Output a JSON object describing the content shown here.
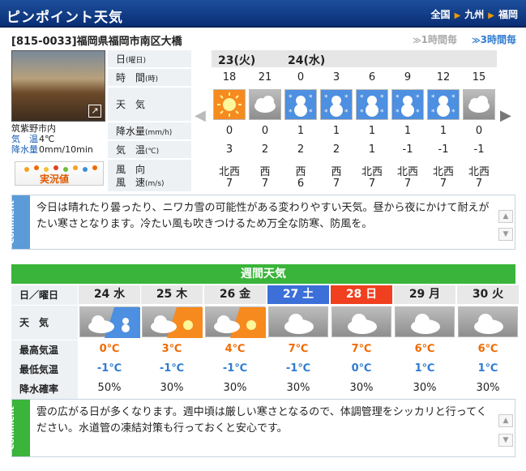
{
  "header": {
    "title": "ピンポイント天気",
    "breadcrumb": [
      "全国",
      "九州",
      "福岡"
    ]
  },
  "location": {
    "address": "[815-0033]福岡県福岡市南区大橋"
  },
  "tabs": {
    "hourly": "1時間毎",
    "threehour": "3時間毎"
  },
  "camera": {
    "place": "筑紫野市内",
    "temp_label": "気　温",
    "temp": "4℃",
    "precip_label": "降水量",
    "precip": "0mm/10min",
    "live": "実況値"
  },
  "rows": {
    "date": "日",
    "date_small": "(曜日)",
    "time": "時　間",
    "time_small": "(時)",
    "weather": "天　気",
    "precip": "降水量",
    "precip_small": "(mm/h)",
    "temp": "気　温",
    "temp_small": "(℃)",
    "wind1": "風　向",
    "wind2": "風　速",
    "wind_small": "(m/s)"
  },
  "dates": [
    "23(火)",
    "24(水)"
  ],
  "hours": [
    {
      "time": "18",
      "icon": "sunny",
      "precip": "0",
      "temp": "3",
      "dir": "北西",
      "speed": "7"
    },
    {
      "time": "21",
      "icon": "cloudy",
      "precip": "0",
      "temp": "2",
      "dir": "西",
      "speed": "7"
    },
    {
      "time": "0",
      "icon": "snow",
      "precip": "1",
      "temp": "2",
      "dir": "西",
      "speed": "6"
    },
    {
      "time": "3",
      "icon": "snow",
      "precip": "1",
      "temp": "2",
      "dir": "西",
      "speed": "7"
    },
    {
      "time": "6",
      "icon": "snow",
      "precip": "1",
      "temp": "1",
      "dir": "北西",
      "speed": "7"
    },
    {
      "time": "9",
      "icon": "snow",
      "precip": "1",
      "temp": "-1",
      "dir": "北西",
      "speed": "7"
    },
    {
      "time": "12",
      "icon": "snow",
      "precip": "1",
      "temp": "-1",
      "dir": "北西",
      "speed": "7"
    },
    {
      "time": "15",
      "icon": "cloudy",
      "precip": "0",
      "temp": "-1",
      "dir": "北西",
      "speed": "7"
    }
  ],
  "comment1": {
    "tag": "Comment",
    "text": "今日は晴れたり曇ったり、ニワカ雪の可能性がある変わりやすい天気。昼から夜にかけて耐えがたい寒さとなります。冷たい風も吹きつけるため万全な防寒、防風を。"
  },
  "weekly": {
    "title": "週間天気",
    "labels": {
      "day": "日／曜日",
      "weather": "天　気",
      "high": "最高気温",
      "low": "最低気温",
      "prob": "降水確率"
    },
    "days": [
      {
        "day": "24 水",
        "kind": "",
        "icon": "cloudy-snow",
        "high": "0℃",
        "low": "-1℃",
        "prob": "50%"
      },
      {
        "day": "25 木",
        "kind": "",
        "icon": "cloudy-sun",
        "high": "3℃",
        "low": "-1℃",
        "prob": "30%"
      },
      {
        "day": "26 金",
        "kind": "",
        "icon": "cloudy-sun",
        "high": "4℃",
        "low": "-1℃",
        "prob": "30%"
      },
      {
        "day": "27 土",
        "kind": "sat",
        "icon": "cloudy",
        "high": "7℃",
        "low": "-1℃",
        "prob": "30%"
      },
      {
        "day": "28 日",
        "kind": "sun",
        "icon": "cloudy",
        "high": "7℃",
        "low": "0℃",
        "prob": "30%"
      },
      {
        "day": "29 月",
        "kind": "",
        "icon": "cloudy",
        "high": "6℃",
        "low": "1℃",
        "prob": "30%"
      },
      {
        "day": "30 火",
        "kind": "",
        "icon": "cloudy",
        "high": "6℃",
        "low": "1℃",
        "prob": "30%"
      }
    ]
  },
  "comment2": {
    "tag": "Comment",
    "text": "雲の広がる日が多くなります。週中頃は厳しい寒さとなるので、体調管理をシッカリと行ってください。水道管の凍結対策も行っておくと安心です。"
  },
  "colors": {
    "header": "#1d4f9c",
    "green": "#3ab43a",
    "saturday": "#3c6fd8",
    "sunday": "#f0401f",
    "high": "#f06a00",
    "low": "#2f7bd0"
  }
}
